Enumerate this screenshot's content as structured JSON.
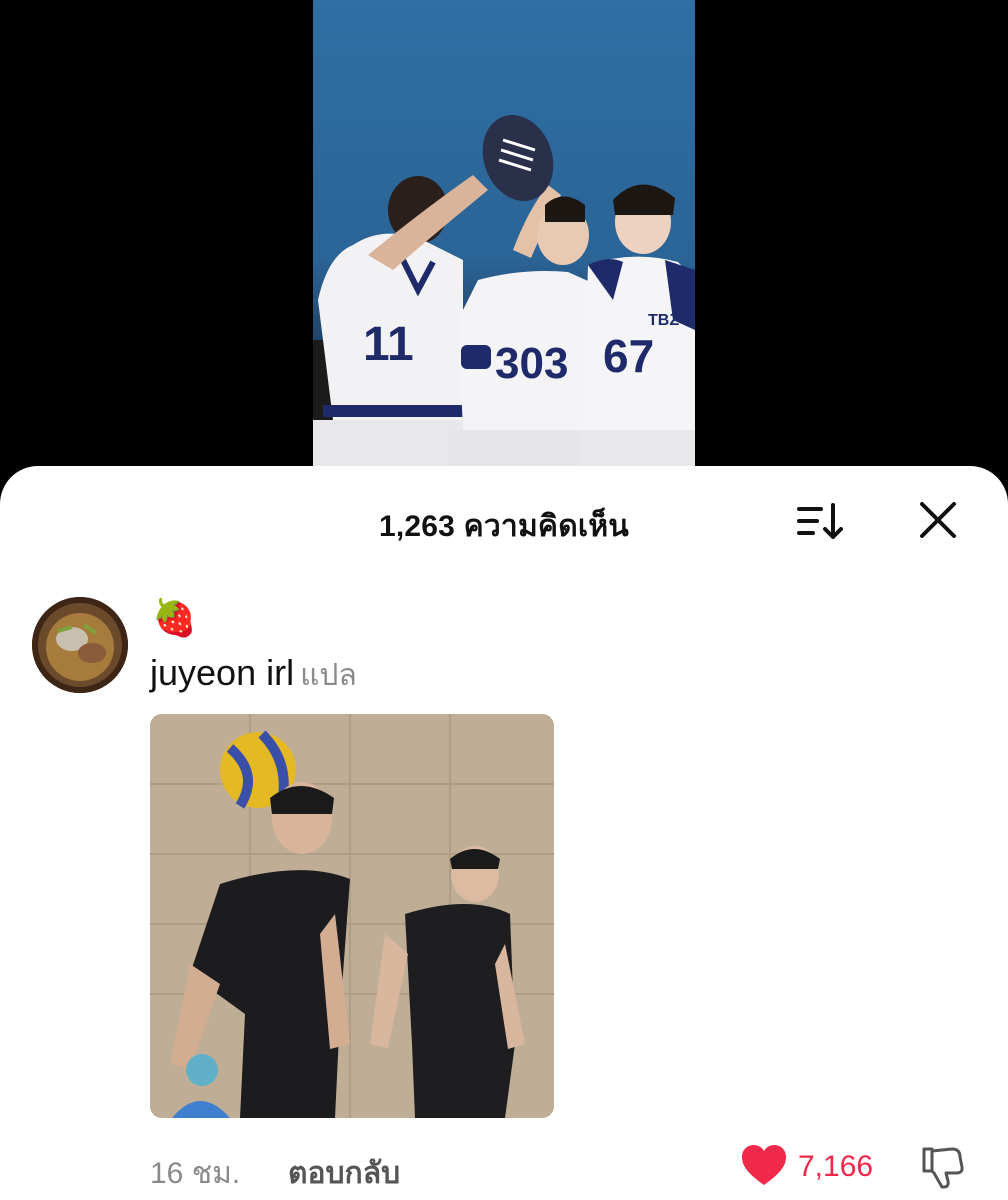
{
  "video": {
    "jersey_numbers": [
      "11",
      "303",
      "67"
    ],
    "jersey_tag": "TBZ"
  },
  "comments_sheet": {
    "title": "1,263 ความคิดเห็น"
  },
  "comment": {
    "emoji": "🍓",
    "username": "juyeon irl",
    "translate_label": "แปล",
    "time": "16 ชม.",
    "reply_label": "ตอบกลับ",
    "like_count": "7,166"
  },
  "colors": {
    "like": "#f02849",
    "accent_blue": "#2f6fa3"
  },
  "icons": [
    "sort-icon",
    "close-icon",
    "heart-icon",
    "dislike-icon"
  ]
}
